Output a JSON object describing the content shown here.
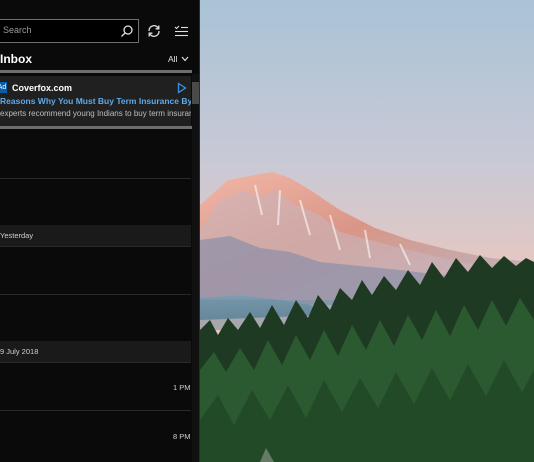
{
  "search": {
    "placeholder": "Search"
  },
  "toolbar": {
    "sync_icon": "sync-icon",
    "filter_icon": "select-mode-icon"
  },
  "folder": {
    "title": "Inbox",
    "filter": "All"
  },
  "ad": {
    "badge": "Ad",
    "sender": "Coverfox.com",
    "subject": "Reasons Why You Must Buy Term Insurance By Th",
    "preview": "experts recommend young Indians to buy term insuran"
  },
  "groups": [
    {
      "label": "Yesterday"
    },
    {
      "label": "9 July 2018"
    }
  ],
  "times": [
    {
      "label": "1 PM"
    },
    {
      "label": "8 PM"
    }
  ],
  "colors": {
    "accent": "#5ea9ea",
    "pane_bg": "#0a0a0a",
    "ad_bg": "#202020"
  }
}
